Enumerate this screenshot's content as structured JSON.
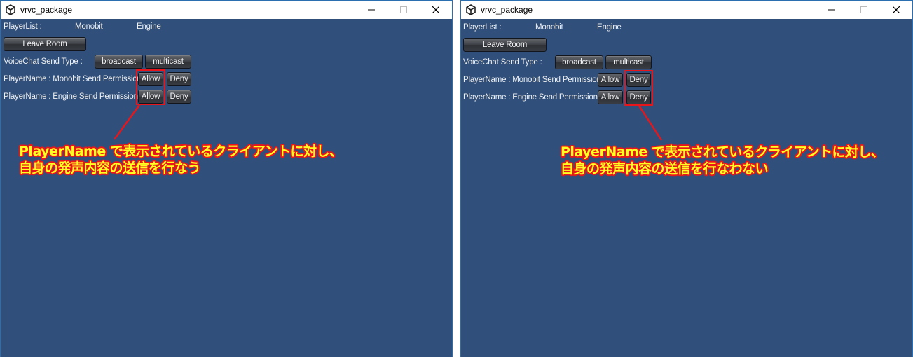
{
  "colors": {
    "client_bg": "#30507b",
    "highlight": "#e8161b",
    "note_text": "#ffff22"
  },
  "left_window": {
    "title": "vrvc_package",
    "icon": "unity-logo-icon",
    "player_list_label": "PlayerList :",
    "player_1": "Monobit",
    "player_2": "Engine",
    "leave_room": "Leave Room",
    "voice_type_label": "VoiceChat Send Type :",
    "broadcast": "broadcast",
    "multicast": "multicast",
    "perm_row_1_label": "PlayerName : Monobit Send Permission:",
    "perm_row_2_label": "PlayerName : Engine Send Permission:",
    "allow": "Allow",
    "deny": "Deny",
    "note_line_1": "PlayerName で表示されているクライアントに対し、",
    "note_line_2": "自身の発声内容の送信を行なう"
  },
  "right_window": {
    "title": "vrvc_package",
    "icon": "unity-logo-icon",
    "player_list_label": "PlayerList :",
    "player_1": "Monobit",
    "player_2": "Engine",
    "leave_room": "Leave Room",
    "voice_type_label": "VoiceChat Send Type :",
    "broadcast": "broadcast",
    "multicast": "multicast",
    "perm_row_1_label": "PlayerName : Monobit Send Permission:",
    "perm_row_2_label": "PlayerName : Engine Send Permission:",
    "allow": "Allow",
    "deny": "Deny",
    "note_line_1": "PlayerName で表示されているクライアントに対し、",
    "note_line_2": "自身の発声内容の送信を行なわない"
  }
}
